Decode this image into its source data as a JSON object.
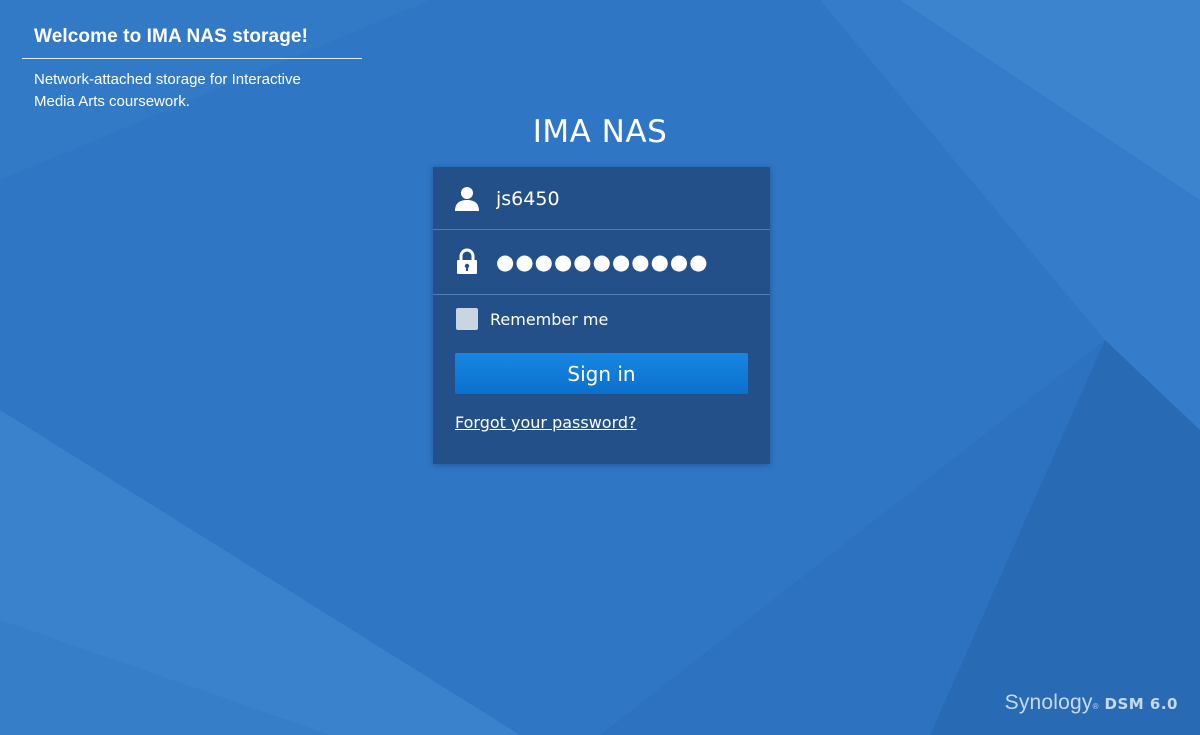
{
  "welcome": {
    "title": "Welcome to IMA NAS storage!",
    "description": "Network-attached storage for Interactive Media Arts coursework."
  },
  "login": {
    "app_title": "IMA NAS",
    "username_value": "js6450",
    "password_masked": "●●●●●●●●●●●",
    "remember_label": "Remember me",
    "remember_checked": false,
    "signin_label": "Sign in",
    "forgot_label": "Forgot your password?",
    "icons": {
      "user": "user-icon",
      "lock": "lock-icon"
    }
  },
  "brand": {
    "name": "Synology",
    "registered": "®",
    "product": "DSM 6.0"
  },
  "colors": {
    "background": "#2f76c4",
    "panel": "#24508a",
    "button": "#1078d6",
    "checkbox": "#c9d5e3"
  }
}
